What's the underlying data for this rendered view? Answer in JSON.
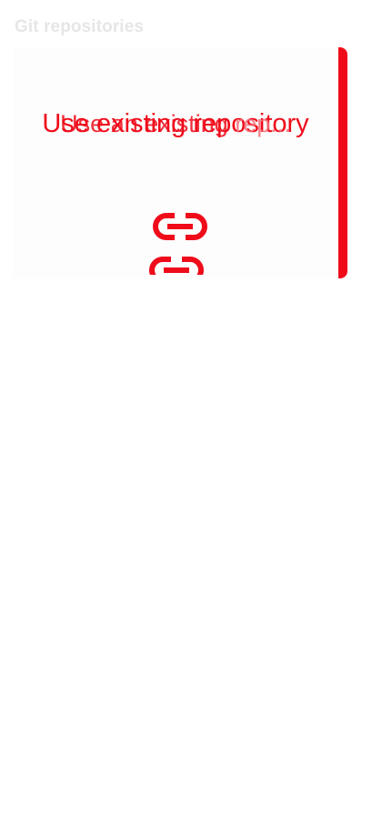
{
  "section": {
    "title": "Git repositories"
  },
  "card": {
    "title": "Use existing repository",
    "ghost_prefix": "Use an existing ",
    "ghost_faded": "rep..."
  },
  "icons": {
    "primary": "link-icon",
    "secondary": "link-icon"
  },
  "colors": {
    "accent": "#ef0b1a",
    "section_title": "#e6e6e6",
    "background": "#ffffff"
  }
}
